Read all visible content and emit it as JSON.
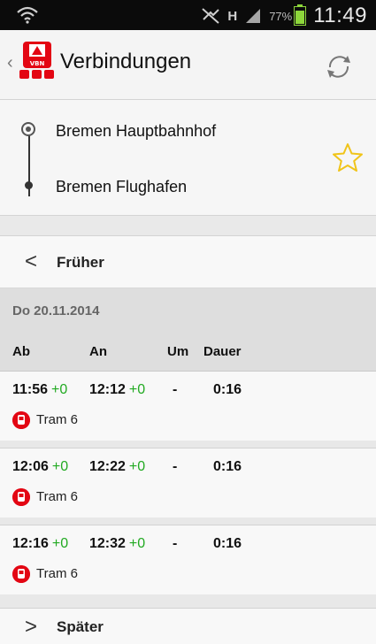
{
  "status_bar": {
    "battery_text": "77%",
    "time": "11:49",
    "signal_label": "H",
    "battery_level": 0.77
  },
  "action_bar": {
    "title": "Verbindungen",
    "logo_text": "VBN"
  },
  "route": {
    "from": "Bremen Hauptbahnhof",
    "to": "Bremen Flughafen"
  },
  "earlier": "Früher",
  "day": {
    "date": "Do 20.11.2014",
    "headers": {
      "ab": "Ab",
      "an": "An",
      "um": "Um",
      "dauer": "Dauer"
    }
  },
  "connections": [
    {
      "dep": "11:56",
      "dep_delay": "+0",
      "arr": "12:12",
      "arr_delay": "+0",
      "changes": "-",
      "duration": "0:16",
      "line": "Tram 6"
    },
    {
      "dep": "12:06",
      "dep_delay": "+0",
      "arr": "12:22",
      "arr_delay": "+0",
      "changes": "-",
      "duration": "0:16",
      "line": "Tram 6"
    },
    {
      "dep": "12:16",
      "dep_delay": "+0",
      "arr": "12:32",
      "arr_delay": "+0",
      "changes": "-",
      "duration": "0:16",
      "line": "Tram 6"
    }
  ],
  "later": "Später",
  "colors": {
    "accent": "#e30613",
    "delay": "#22aa22",
    "star": "#f0c419"
  }
}
